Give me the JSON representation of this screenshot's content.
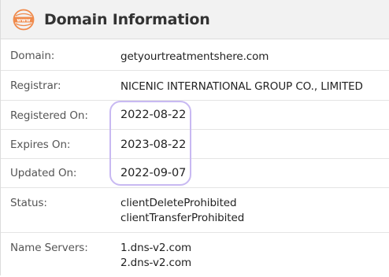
{
  "header": {
    "logo_icon": "www-globe-icon",
    "logo_text": "www",
    "logo_color": "#f08a4b",
    "title": "Domain Information"
  },
  "rows": [
    {
      "label": "Domain:",
      "values": [
        "getyourtreatmentshere.com"
      ]
    },
    {
      "label": "Registrar:",
      "values": [
        "NICENIC INTERNATIONAL GROUP CO., LIMITED"
      ]
    },
    {
      "label": "Registered On:",
      "values": [
        "2022-08-22"
      ]
    },
    {
      "label": "Expires On:",
      "values": [
        "2023-08-22"
      ]
    },
    {
      "label": "Updated On:",
      "values": [
        "2022-09-07"
      ]
    },
    {
      "label": "Status:",
      "values": [
        "clientDeleteProhibited",
        "clientTransferProhibited"
      ]
    },
    {
      "label": "Name Servers:",
      "values": [
        "1.dns-v2.com",
        "2.dns-v2.com"
      ]
    }
  ],
  "highlight_color": "#c8b9f2"
}
